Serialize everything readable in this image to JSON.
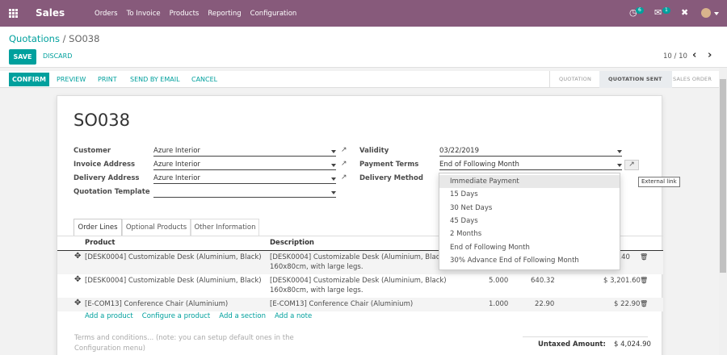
{
  "app": {
    "brand": "Sales",
    "menu": [
      "Orders",
      "To Invoice",
      "Products",
      "Reporting",
      "Configuration"
    ],
    "activity_count": "6",
    "messages_count": "1"
  },
  "breadcrumb": {
    "parent": "Quotations",
    "sep": "/",
    "current": "SO038"
  },
  "control": {
    "save": "SAVE",
    "discard": "DISCARD",
    "pager": "10 / 10"
  },
  "header_buttons": {
    "confirm": "CONFIRM",
    "preview": "PREVIEW",
    "print": "PRINT",
    "send": "SEND BY EMAIL",
    "cancel": "CANCEL"
  },
  "stages": [
    "QUOTATION",
    "QUOTATION SENT",
    "SALES ORDER"
  ],
  "form": {
    "title": "SO038",
    "customer_label": "Customer",
    "customer": "Azure Interior",
    "invoice_label": "Invoice Address",
    "invoice": "Azure Interior",
    "delivery_label": "Delivery Address",
    "delivery": "Azure Interior",
    "template_label": "Quotation Template",
    "template": "",
    "validity_label": "Validity",
    "validity": "03/22/2019",
    "terms_label": "Payment Terms",
    "terms": "End of Following Month",
    "delivery_method_label": "Delivery Method"
  },
  "tabs": [
    "Order Lines",
    "Optional Products",
    "Other Information"
  ],
  "table": {
    "headers": {
      "product": "Product",
      "description": "Description"
    },
    "rows": [
      {
        "product": "[DESK0004] Customizable Desk (Aluminium, Black)",
        "desc1": "[DESK0004] Customizable Desk (Aluminium, Black)",
        "desc2": "160x80cm, with large legs.",
        "qty": "",
        "price": "",
        "subtotal": "0.40"
      },
      {
        "product": "[DESK0004] Customizable Desk (Aluminium, Black)",
        "desc1": "[DESK0004] Customizable Desk (Aluminium, Black)",
        "desc2": "160x80cm, with large legs.",
        "qty": "5.000",
        "price": "640.32",
        "subtotal": "$ 3,201.60"
      },
      {
        "product": "[E-COM13] Conference Chair (Aluminium)",
        "desc1": "[E-COM13] Conference Chair (Aluminium)",
        "desc2": "",
        "qty": "1.000",
        "price": "22.90",
        "subtotal": "$ 22.90"
      }
    ],
    "add_links": [
      "Add a product",
      "Configure a product",
      "Add a section",
      "Add a note"
    ]
  },
  "footer": {
    "terms_placeholder": "Terms and conditions... (note: you can setup default ones in the Configuration menu)",
    "untaxed_label": "Untaxed Amount:",
    "untaxed_value": "$ 4,024.90"
  },
  "dropdown": {
    "options": [
      "Immediate Payment",
      "15 Days",
      "30 Net Days",
      "45 Days",
      "2 Months",
      "End of Following Month",
      "30% Advance End of Following Month"
    ],
    "highlighted": 0
  },
  "tooltip": "External link",
  "colors": {
    "primary": "#875a7b",
    "accent": "#00a09d"
  }
}
